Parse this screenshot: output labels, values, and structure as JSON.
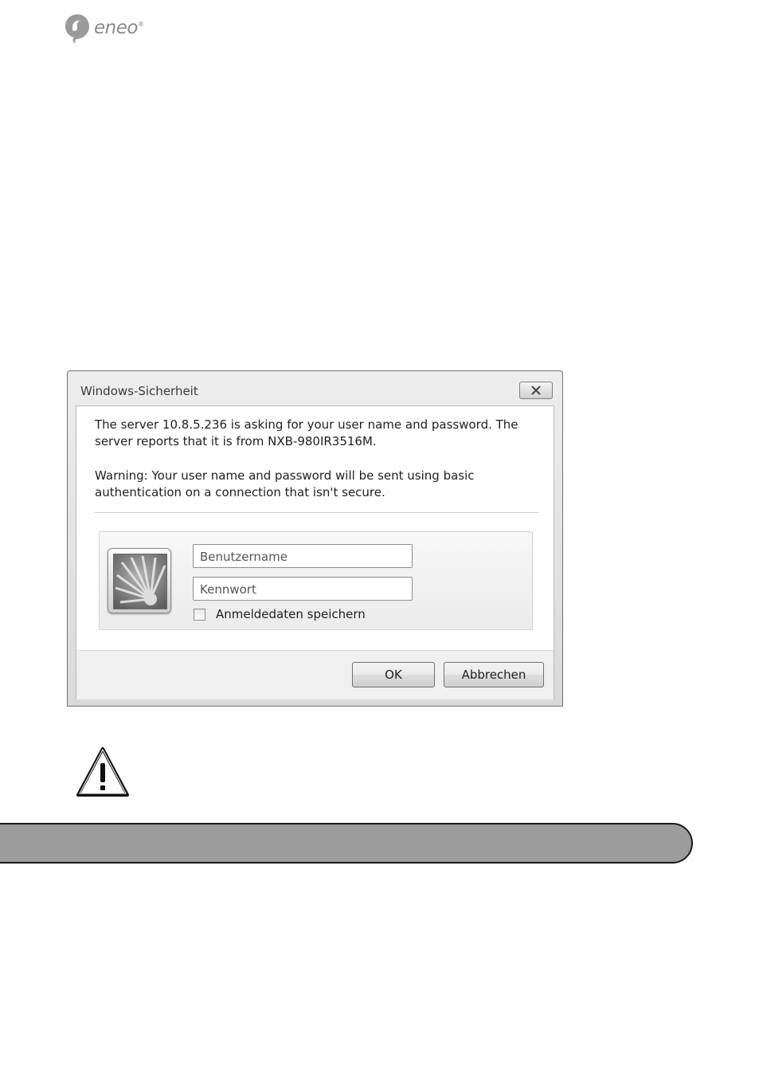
{
  "brand": {
    "name": "eneo"
  },
  "dialog": {
    "title": "Windows-Sicherheit",
    "message_line1": "The server 10.8.5.236 is asking for your user name and password. The\nserver reports that it is from NXB-980IR3516M.",
    "message_line2": "Warning: Your user name and password will be sent using basic\nauthentication on a connection that isn't secure.",
    "username_placeholder": "Benutzername",
    "password_placeholder": "Kennwort",
    "remember_label": "Anmeldedaten speichern",
    "ok_label": "OK",
    "cancel_label": "Abbrechen"
  },
  "icons": {
    "logo": "eneo-logo-icon",
    "close": "close-icon",
    "avatar": "user-tile-flower-icon",
    "warning": "warning-triangle-icon"
  },
  "colors": {
    "bar_fill": "#9c9c9c",
    "logo_gray": "#8a8a8a"
  }
}
